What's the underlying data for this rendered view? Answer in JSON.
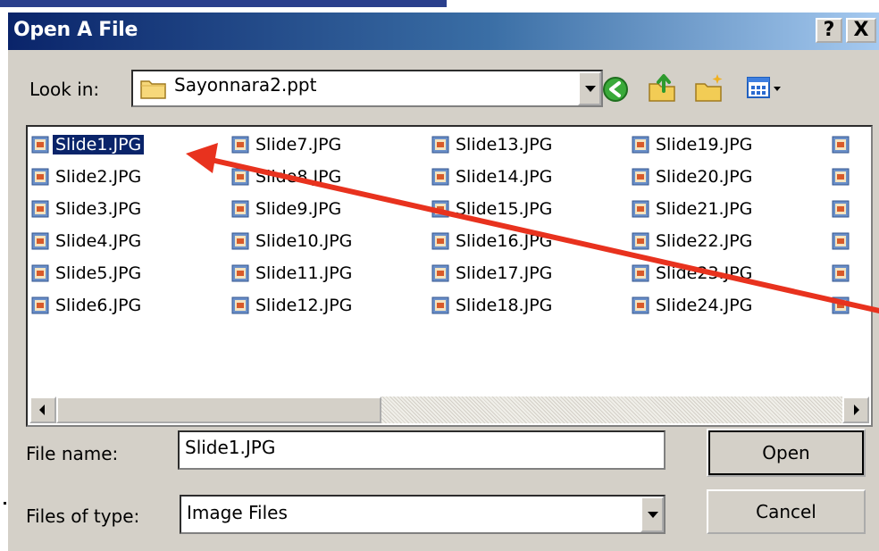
{
  "dialog": {
    "title": "Open A File",
    "help_label": "?",
    "close_label": "X"
  },
  "look_in": {
    "label": "Look in:",
    "value": "Sayonnara2.ppt",
    "icon": "folder-icon"
  },
  "toolbar": {
    "back_icon": "back-arrow-icon",
    "up_icon": "up-folder-icon",
    "new_folder_icon": "new-folder-icon",
    "views_icon": "views-menu-icon"
  },
  "files": {
    "columns": [
      [
        "Slide1.JPG",
        "Slide2.JPG",
        "Slide3.JPG",
        "Slide4.JPG",
        "Slide5.JPG",
        "Slide6.JPG"
      ],
      [
        "Slide7.JPG",
        "Slide8.JPG",
        "Slide9.JPG",
        "Slide10.JPG",
        "Slide11.JPG",
        "Slide12.JPG"
      ],
      [
        "Slide13.JPG",
        "Slide14.JPG",
        "Slide15.JPG",
        "Slide16.JPG",
        "Slide17.JPG",
        "Slide18.JPG"
      ],
      [
        "Slide19.JPG",
        "Slide20.JPG",
        "Slide21.JPG",
        "Slide22.JPG",
        "Slide23.JPG",
        "Slide24.JPG"
      ]
    ],
    "selected": "Slide1.JPG"
  },
  "file_name": {
    "label": "File name:",
    "value": "Slide1.JPG"
  },
  "file_type": {
    "label": "Files of type:",
    "value": "Image Files"
  },
  "buttons": {
    "open": "Open",
    "cancel": "Cancel"
  },
  "annotation": {
    "arrow_color": "#e8321e"
  }
}
